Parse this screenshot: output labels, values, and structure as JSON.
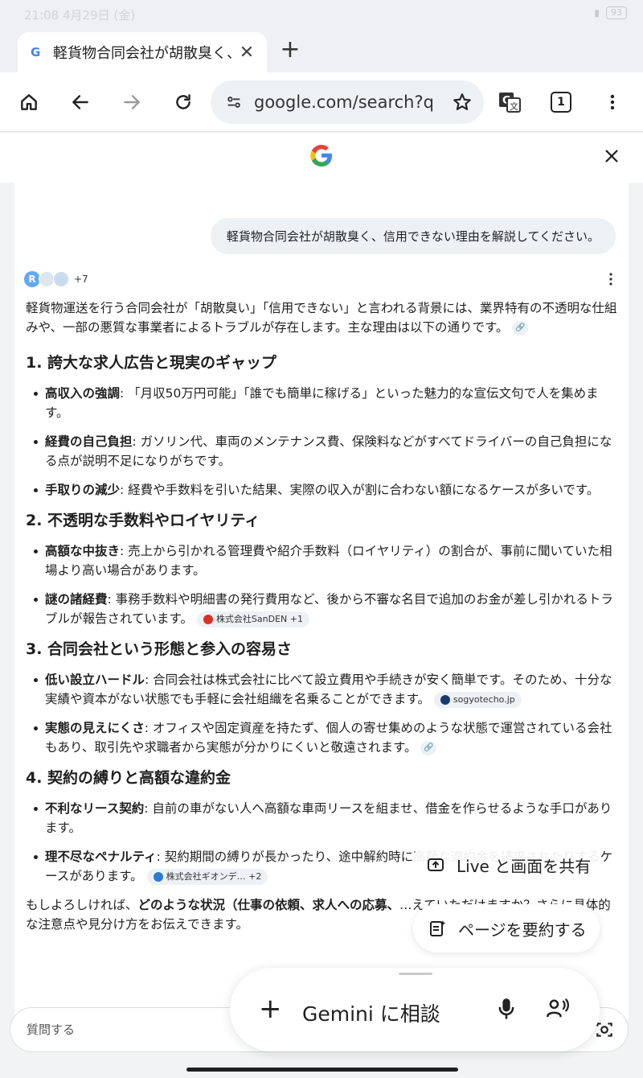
{
  "status_bar": {
    "time": "21:08",
    "date": "4月29日 (金)",
    "battery": "93"
  },
  "tab": {
    "title": "軽貨物合同会社が胡散臭く、",
    "close_label": "✕"
  },
  "toolbar": {
    "url": "google.com/search?q",
    "tab_count": "1"
  },
  "google": {
    "logo_letter": "G"
  },
  "chat": {
    "user_message": "軽貨物合同会社が胡散臭く、信用できない理由を解説してください。",
    "sources_more": "+7",
    "intro": "軽貨物運送を行う合同会社が「胡散臭い」「信用できない」と言われる背景には、業界特有の不透明な仕組みや、一部の悪質な事業者によるトラブルが存在します。主な理由は以下の通りです。",
    "sections": [
      {
        "heading": "1. 誇大な求人広告と現実のギャップ",
        "items": [
          {
            "term": "高収入の強調",
            "text": ": 「月収50万円可能」「誰でも簡単に稼げる」といった魅力的な宣伝文句で人を集めます。"
          },
          {
            "term": "経費の自己負担",
            "text": ": ガソリン代、車両のメンテナンス費、保険料などがすべてドライバーの自己負担になる点が説明不足になりがちです。"
          },
          {
            "term": "手取りの減少",
            "text": ": 経費や手数料を引いた結果、実際の収入が割に合わない額になるケースが多いです。"
          }
        ]
      },
      {
        "heading": "2. 不透明な手数料やロイヤリティ",
        "items": [
          {
            "term": "高額な中抜き",
            "text": ": 売上から引かれる管理費や紹介手数料（ロイヤリティ）の割合が、事前に聞いていた相場より高い場合があります。"
          },
          {
            "term": "謎の諸経費",
            "text": ": 事務手数料や明細書の発行費用など、後から不審な名目で追加のお金が差し引かれるトラブルが報告されています。",
            "chip": "株式会社SanDEN +1"
          }
        ]
      },
      {
        "heading": "3. 合同会社という形態と参入の容易さ",
        "items": [
          {
            "term": "低い設立ハードル",
            "text": ": 合同会社は株式会社に比べて設立費用や手続きが安く簡単です。そのため、十分な実績や資本がない状態でも手軽に会社組織を名乗ることができます。",
            "chip": "sogyotecho.jp"
          },
          {
            "term": "実態の見えにくさ",
            "text": ": オフィスや固定資産を持たず、個人の寄せ集めのような状態で運営されている会社もあり、取引先や求職者から実態が分かりにくいと敬遠されます。"
          }
        ]
      },
      {
        "heading": "4. 契約の縛りと高額な違約金",
        "items": [
          {
            "term": "不利なリース契約",
            "text": ": 自前の車がない人へ高額な車両リースを組ませ、借金を作らせるような手口があります。"
          },
          {
            "term": "理不尽なペナルティ",
            "text": ": 契約期間の縛りが長かったり、途中解約時に高額な違約金を請求されたりするケースがあります。",
            "chip": "株式会社ギオンデ… +2"
          }
        ]
      }
    ],
    "closing_pre": "もしよろしければ、",
    "closing_bold": "どのような状況（仕事の依頼、求人への応募、",
    "closing_post": "…えていただけますか？さらに具体的な注意点や見分け方をお伝えできます。"
  },
  "overlay": {
    "share_live": "Live と画面を共有",
    "summarize": "ページを要約する",
    "gemini_label": "Gemini に相談"
  },
  "input": {
    "placeholder": "質問する"
  },
  "colors": {
    "accent_blue": "#4285f4",
    "surface": "#ffffff",
    "chrome_bg": "#eef0f3"
  }
}
